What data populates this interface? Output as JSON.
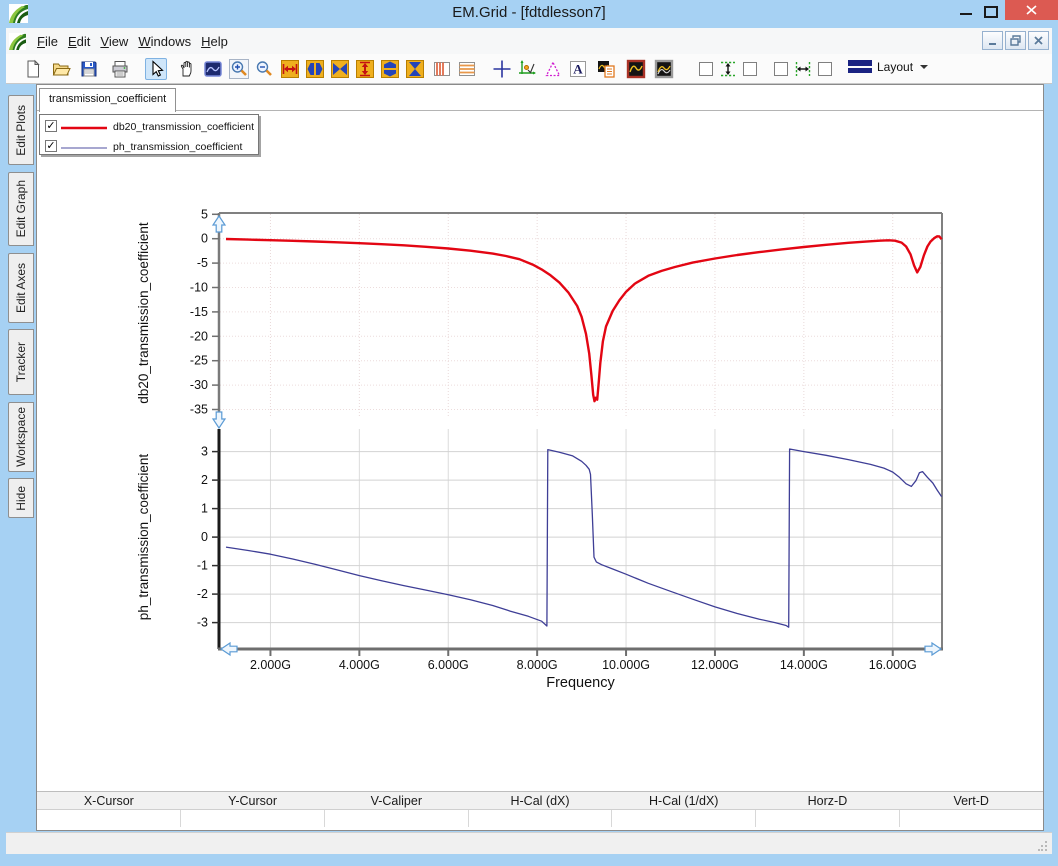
{
  "window": {
    "title": "EM.Grid - [fdtdlesson7]"
  },
  "menu": {
    "items": [
      "File",
      "Edit",
      "View",
      "Windows",
      "Help"
    ]
  },
  "toolbar": {
    "layout_label": "Layout",
    "icons": [
      "new-document",
      "open-file",
      "save",
      "print",
      "select-cursor",
      "pan-hand",
      "zoom-region",
      "zoom-in",
      "zoom-out",
      "expand-x",
      "stretch-x",
      "mirror-x",
      "expand-y",
      "stretch-y",
      "mirror-y",
      "vertical-stripes",
      "horizontal-stripes",
      "crosshair",
      "tracker",
      "delta-caliper",
      "text-annotation",
      "report",
      "single-trace",
      "multi-trace",
      "left-y-checkbox",
      "fit-vertical",
      "right-y-checkbox",
      "left-x-checkbox",
      "fit-horizontal",
      "right-x-checkbox",
      "layout-menu"
    ]
  },
  "sidebar": {
    "tabs": [
      "Edit Plots",
      "Edit Graph",
      "Edit Axes",
      "Tracker",
      "Workspace",
      "Hide"
    ]
  },
  "document_tab": {
    "label": "transmission_coefficient"
  },
  "cursor_table": {
    "headers": [
      "X-Cursor",
      "Y-Cursor",
      "V-Caliper",
      "H-Cal (dX)",
      "H-Cal (1/dX)",
      "Horz-D",
      "Vert-D"
    ],
    "values": [
      "",
      "",
      "",
      "",
      "",
      "",
      ""
    ]
  },
  "chart_data": {
    "type": "line",
    "xlabel": "Frequency",
    "x_unit": "GHz",
    "x_range": [
      0.84,
      17.11
    ],
    "x_ticks": [
      {
        "v": 2,
        "label": "2.000G"
      },
      {
        "v": 4,
        "label": "4.000G"
      },
      {
        "v": 6,
        "label": "6.000G"
      },
      {
        "v": 8,
        "label": "8.000G"
      },
      {
        "v": 10,
        "label": "10.000G"
      },
      {
        "v": 12,
        "label": "12.000G"
      },
      {
        "v": 14,
        "label": "14.000G"
      },
      {
        "v": 16,
        "label": "16.000G"
      }
    ],
    "legend": [
      {
        "label": "db20_transmission_coefficient",
        "color": "#e30613",
        "sample_color": "#e30613",
        "checked": true,
        "sample_width": 2.5
      },
      {
        "label": "ph_transmission_coefficient",
        "color": "#3e3e96",
        "sample_color": "#8a8ac0",
        "checked": true,
        "sample_width": 1.5
      }
    ],
    "panels": [
      {
        "name": "db20_transmission_coefficient",
        "ylabel": "db20_transmission_coefficient",
        "y_ticks": [
          5,
          0,
          -5,
          -10,
          -15,
          -20,
          -25,
          -30,
          -35
        ],
        "y_range": [
          5.3,
          -35.3
        ],
        "color": "#e30613",
        "points": [
          [
            1,
            -0.07
          ],
          [
            1.5,
            -0.18
          ],
          [
            2,
            -0.3
          ],
          [
            2.5,
            -0.44
          ],
          [
            3,
            -0.58
          ],
          [
            3.5,
            -0.74
          ],
          [
            4,
            -0.92
          ],
          [
            4.5,
            -1.12
          ],
          [
            5,
            -1.36
          ],
          [
            5.5,
            -1.65
          ],
          [
            6,
            -2.0
          ],
          [
            6.5,
            -2.45
          ],
          [
            7,
            -3.05
          ],
          [
            7.3,
            -3.55
          ],
          [
            7.6,
            -4.2
          ],
          [
            7.9,
            -5.3
          ],
          [
            8.1,
            -6.3
          ],
          [
            8.3,
            -7.5
          ],
          [
            8.5,
            -9.0
          ],
          [
            8.7,
            -11.0
          ],
          [
            8.9,
            -13.8
          ],
          [
            9.0,
            -16.0
          ],
          [
            9.1,
            -19.5
          ],
          [
            9.17,
            -23.5
          ],
          [
            9.22,
            -28.0
          ],
          [
            9.26,
            -32.0
          ],
          [
            9.29,
            -33.3
          ],
          [
            9.32,
            -32.6
          ],
          [
            9.35,
            -33.0
          ],
          [
            9.38,
            -30.0
          ],
          [
            9.42,
            -25.5
          ],
          [
            9.48,
            -21.0
          ],
          [
            9.55,
            -18.0
          ],
          [
            9.7,
            -14.8
          ],
          [
            9.85,
            -12.6
          ],
          [
            10,
            -10.9
          ],
          [
            10.2,
            -9.2
          ],
          [
            10.5,
            -7.6
          ],
          [
            10.8,
            -6.6
          ],
          [
            11.1,
            -5.8
          ],
          [
            11.5,
            -4.9
          ],
          [
            12,
            -4.05
          ],
          [
            12.5,
            -3.35
          ],
          [
            13,
            -2.75
          ],
          [
            13.5,
            -2.2
          ],
          [
            14,
            -1.7
          ],
          [
            14.5,
            -1.25
          ],
          [
            15,
            -0.85
          ],
          [
            15.4,
            -0.6
          ],
          [
            15.7,
            -0.4
          ],
          [
            15.9,
            -0.32
          ],
          [
            16.05,
            -0.4
          ],
          [
            16.2,
            -0.8
          ],
          [
            16.3,
            -1.6
          ],
          [
            16.4,
            -3.2
          ],
          [
            16.48,
            -5.5
          ],
          [
            16.55,
            -6.9
          ],
          [
            16.62,
            -5.8
          ],
          [
            16.7,
            -3.4
          ],
          [
            16.78,
            -1.6
          ],
          [
            16.85,
            -0.6
          ],
          [
            16.93,
            0.1
          ],
          [
            17.0,
            0.5
          ],
          [
            17.05,
            0.45
          ],
          [
            17.1,
            -0.1
          ]
        ]
      },
      {
        "name": "ph_transmission_coefficient",
        "ylabel": "ph_transmission_coefficient",
        "y_ticks": [
          3,
          2,
          1,
          0,
          -1,
          -2,
          -3
        ],
        "y_range": [
          3.84,
          -3.93
        ],
        "color": "#3e3e96",
        "points": [
          [
            1,
            -0.35
          ],
          [
            1.5,
            -0.47
          ],
          [
            2,
            -0.6
          ],
          [
            2.5,
            -0.77
          ],
          [
            3,
            -0.95
          ],
          [
            3.5,
            -1.15
          ],
          [
            4,
            -1.35
          ],
          [
            4.5,
            -1.53
          ],
          [
            5,
            -1.7
          ],
          [
            5.5,
            -1.86
          ],
          [
            6,
            -2.02
          ],
          [
            6.5,
            -2.2
          ],
          [
            7,
            -2.4
          ],
          [
            7.4,
            -2.6
          ],
          [
            7.8,
            -2.78
          ],
          [
            8.1,
            -2.95
          ],
          [
            8.22,
            -3.12
          ],
          [
            8.24,
            3.07
          ],
          [
            8.5,
            2.98
          ],
          [
            8.8,
            2.85
          ],
          [
            9.0,
            2.66
          ],
          [
            9.1,
            2.52
          ],
          [
            9.17,
            2.38
          ],
          [
            9.2,
            2.2
          ],
          [
            9.24,
            0.8
          ],
          [
            9.28,
            -0.7
          ],
          [
            9.33,
            -0.87
          ],
          [
            9.45,
            -0.97
          ],
          [
            9.7,
            -1.12
          ],
          [
            10,
            -1.3
          ],
          [
            10.5,
            -1.62
          ],
          [
            11,
            -1.9
          ],
          [
            11.5,
            -2.18
          ],
          [
            12,
            -2.45
          ],
          [
            12.5,
            -2.68
          ],
          [
            13,
            -2.88
          ],
          [
            13.35,
            -3.0
          ],
          [
            13.6,
            -3.1
          ],
          [
            13.66,
            -3.16
          ],
          [
            13.68,
            3.09
          ],
          [
            14,
            3.0
          ],
          [
            14.5,
            2.87
          ],
          [
            15,
            2.72
          ],
          [
            15.5,
            2.55
          ],
          [
            15.8,
            2.42
          ],
          [
            16.0,
            2.28
          ],
          [
            16.15,
            2.1
          ],
          [
            16.3,
            1.87
          ],
          [
            16.42,
            1.78
          ],
          [
            16.52,
            1.98
          ],
          [
            16.6,
            2.26
          ],
          [
            16.67,
            2.3
          ],
          [
            16.78,
            2.1
          ],
          [
            16.9,
            1.9
          ],
          [
            17.0,
            1.65
          ],
          [
            17.1,
            1.42
          ]
        ]
      }
    ]
  }
}
